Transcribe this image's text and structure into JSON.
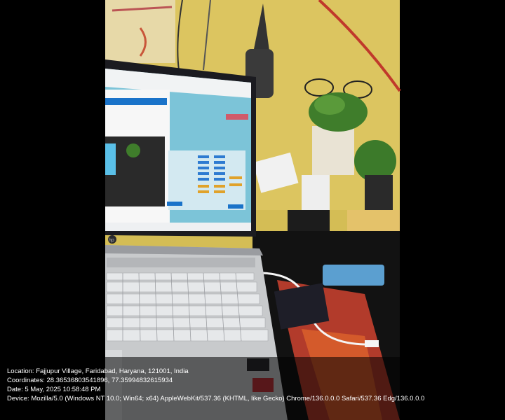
{
  "overlay": {
    "location": "Location: Fajjupur Village, Faridabad, Haryana, 121001, India",
    "coordinates": "Coordinates: 28.36536803541896, 77.35994832615934",
    "date": "Date: 5 May, 2025 10:58:48 PM",
    "device": "Device: Mozilla/5.0 (Windows NT 10.0; Win64; x64) AppleWebKit/537.36 (KHTML, like Gecko) Chrome/136.0.0.0 Safari/537.36 Edg/136.0.0.0"
  },
  "colors": {
    "wall": "#d8c25a",
    "screen_bg": "#7cc4d8",
    "laptop_body": "#c8cacc",
    "keyboard_keys": "#e6e8ea",
    "mat_red": "#c0392b"
  },
  "laptop": {
    "brand_logo": "hp"
  }
}
